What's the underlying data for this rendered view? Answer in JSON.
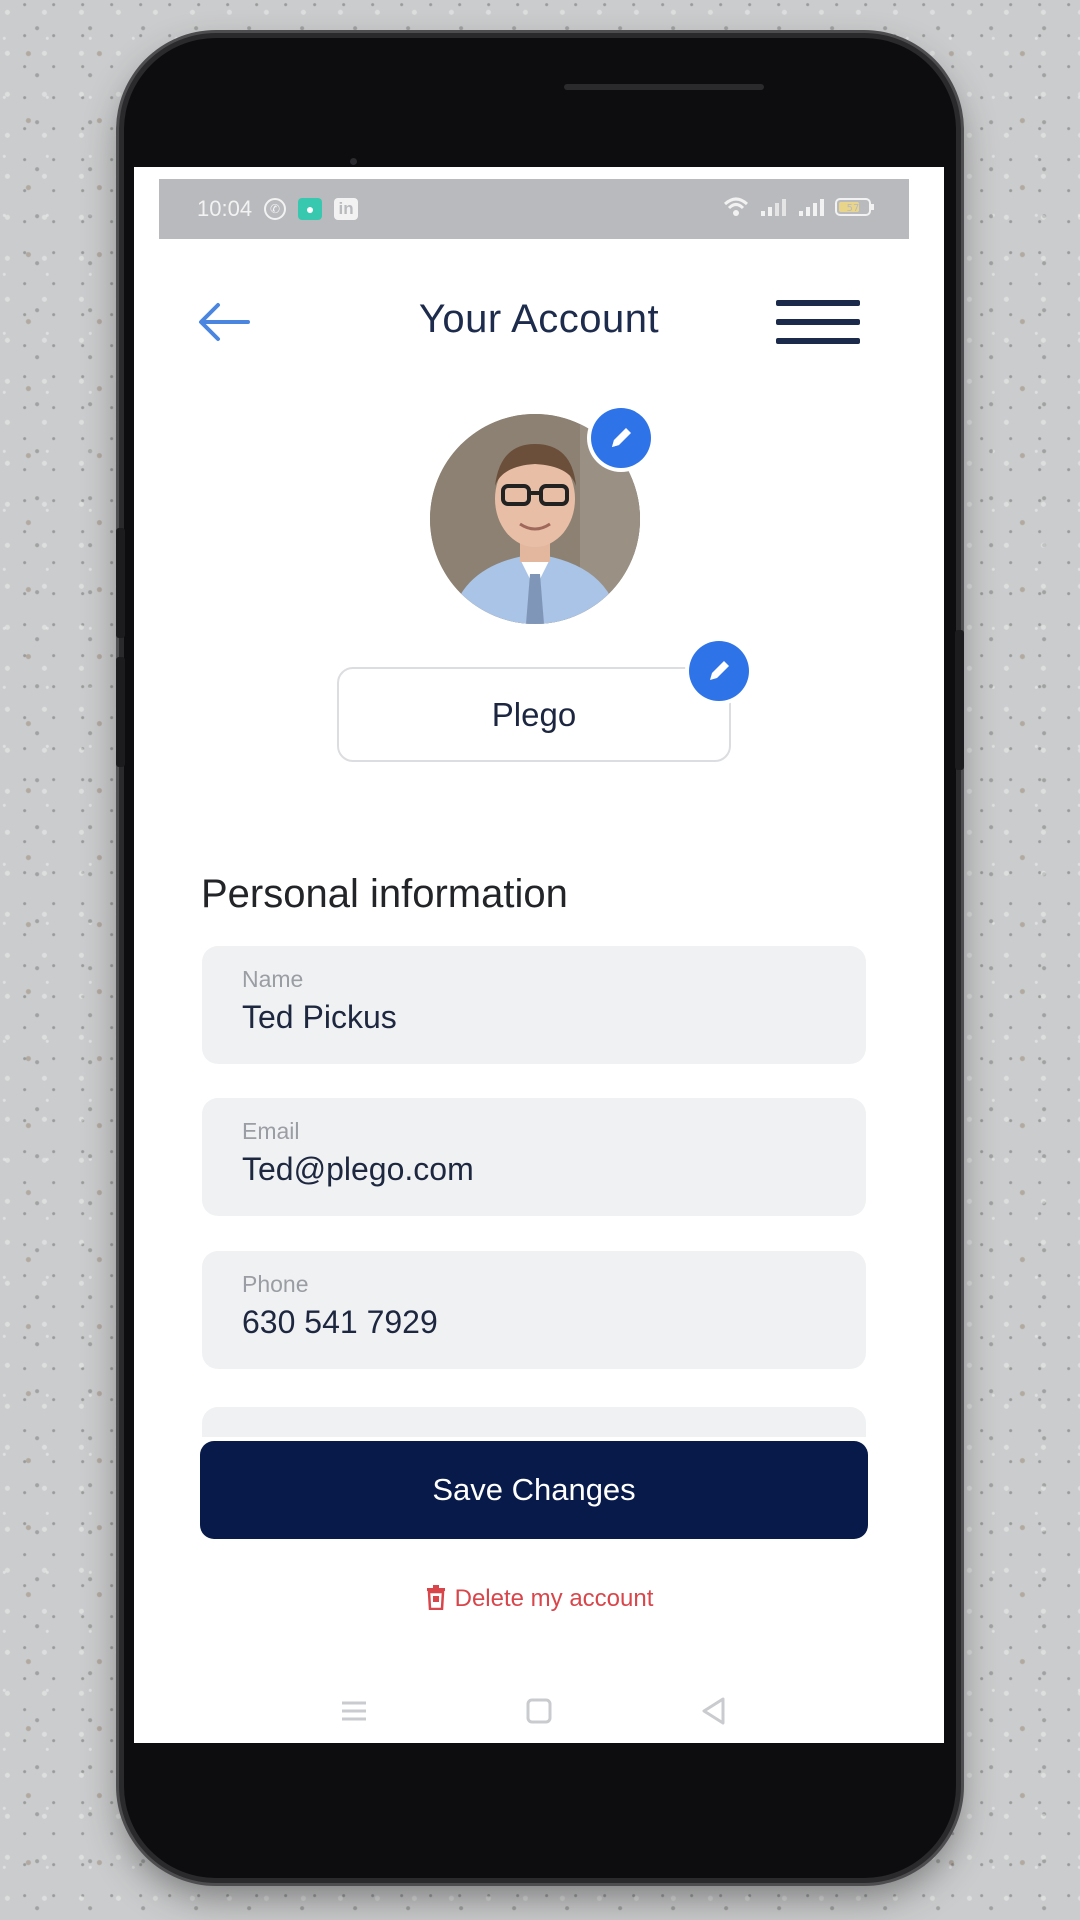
{
  "status_bar": {
    "time": "10:04",
    "notification_icons": [
      "whatsapp-icon",
      "chat-app-icon",
      "linkedin-icon"
    ],
    "system_icons": [
      "wifi-icon",
      "signal-icon",
      "signal-icon",
      "battery-icon"
    ],
    "battery_level": "57"
  },
  "header": {
    "title": "Your Account",
    "back_icon": "arrow-left-icon",
    "menu_icon": "hamburger-menu-icon"
  },
  "profile": {
    "company": "Plego"
  },
  "personal_info": {
    "title": "Personal information",
    "fields": [
      {
        "label": "Name",
        "value": "Ted Pickus"
      },
      {
        "label": "Email",
        "value": "Ted@plego.com"
      },
      {
        "label": "Phone",
        "value": "630 541 7929"
      }
    ]
  },
  "actions": {
    "save_label": "Save Changes",
    "delete_label": "Delete my account"
  },
  "nav_bar": {
    "items": [
      "recents-icon",
      "home-icon",
      "back-icon"
    ]
  },
  "colors": {
    "primary": "#071a4a",
    "accent": "#2f73e9",
    "danger": "#d8464b",
    "field_bg": "#f0f1f3"
  }
}
